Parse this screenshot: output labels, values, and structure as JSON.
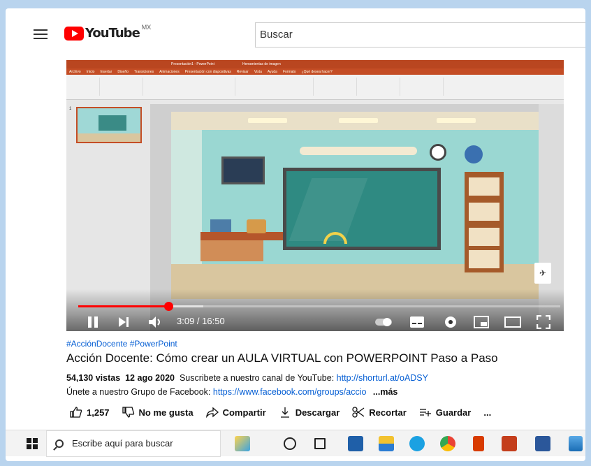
{
  "header": {
    "logo_text": "YouTube",
    "region": "MX",
    "search_placeholder": "Buscar"
  },
  "video": {
    "current_time": "3:09 / 16:50",
    "progress": 0.187,
    "buffered": 0.26,
    "ribbon_title": "Presentación1 - PowerPoint",
    "ribbon_tools": "Herramientas de imagen",
    "ribbon_tabs": [
      "Archivo",
      "Inicio",
      "Insertar",
      "Diseño",
      "Transiciones",
      "Animaciones",
      "Presentación con diapositivas",
      "Revisar",
      "Vista",
      "Ayuda",
      "Formato",
      "¿Qué desea hacer?"
    ],
    "slide_number": "1"
  },
  "details": {
    "hashtags": "#AcciónDocente #PowerPoint",
    "title": "Acción Docente: Cómo crear un AULA VIRTUAL con POWERPOINT Paso a Paso",
    "views": "54,130 vistas",
    "date": "12 ago 2020",
    "desc_line1": "Suscribete a nuestro canal de YouTube:",
    "link1": "http://shorturl.at/oADSY",
    "desc_line2": "Únete a nuestro Grupo de Facebook:",
    "link2": "https://www.facebook.com/groups/accio",
    "more": "...más"
  },
  "actions": {
    "likes": "1,257",
    "dislike": "No me gusta",
    "share": "Compartir",
    "download": "Descargar",
    "clip": "Recortar",
    "save": "Guardar",
    "more": "..."
  },
  "taskbar": {
    "search_placeholder": "Escribe aquí para buscar"
  },
  "colors": {
    "youtube_red": "#ff0000",
    "link_blue": "#065fd4",
    "ppt_orange": "#c44d25"
  }
}
